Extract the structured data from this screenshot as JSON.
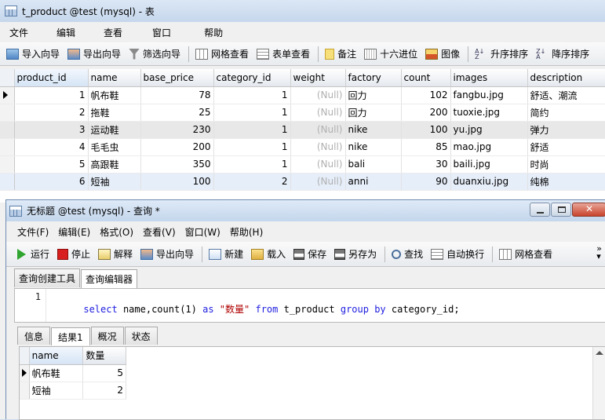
{
  "back_window": {
    "title": "t_product @test (mysql) - 表",
    "menu": [
      "文件",
      "编辑",
      "查看",
      "窗口",
      "帮助"
    ],
    "toolbar": [
      "导入向导",
      "导出向导",
      "筛选向导",
      "网格查看",
      "表单查看",
      "备注",
      "十六进位",
      "图像",
      "升序排序",
      "降序排序"
    ],
    "columns": [
      "product_id",
      "name",
      "base_price",
      "category_id",
      "weight",
      "factory",
      "count",
      "images",
      "description"
    ],
    "rows": [
      {
        "product_id": "1",
        "name": "帆布鞋",
        "base_price": "78",
        "category_id": "1",
        "weight": "(Null)",
        "factory": "回力",
        "count": "102",
        "images": "fangbu.jpg",
        "description": "舒适、潮流"
      },
      {
        "product_id": "2",
        "name": "拖鞋",
        "base_price": "25",
        "category_id": "1",
        "weight": "(Null)",
        "factory": "回力",
        "count": "200",
        "images": "tuoxie.jpg",
        "description": "简约"
      },
      {
        "product_id": "3",
        "name": "运动鞋",
        "base_price": "230",
        "category_id": "1",
        "weight": "(Null)",
        "factory": "nike",
        "count": "100",
        "images": "yu.jpg",
        "description": "弹力"
      },
      {
        "product_id": "4",
        "name": "毛毛虫",
        "base_price": "200",
        "category_id": "1",
        "weight": "(Null)",
        "factory": "nike",
        "count": "85",
        "images": "mao.jpg",
        "description": "舒适"
      },
      {
        "product_id": "5",
        "name": "高跟鞋",
        "base_price": "350",
        "category_id": "1",
        "weight": "(Null)",
        "factory": "bali",
        "count": "30",
        "images": "baili.jpg",
        "description": "时尚"
      },
      {
        "product_id": "6",
        "name": "短袖",
        "base_price": "100",
        "category_id": "2",
        "weight": "(Null)",
        "factory": "anni",
        "count": "90",
        "images": "duanxiu.jpg",
        "description": "纯棉"
      }
    ]
  },
  "front_window": {
    "title": "无标题 @test (mysql) - 查询 *",
    "menu": [
      "文件(F)",
      "编辑(E)",
      "格式(O)",
      "查看(V)",
      "窗口(W)",
      "帮助(H)"
    ],
    "toolbar": [
      "运行",
      "停止",
      "解释",
      "导出向导",
      "新建",
      "载入",
      "保存",
      "另存为",
      "查找",
      "自动换行",
      "网格查看"
    ],
    "editor_tabs": [
      "查询创建工具",
      "查询编辑器"
    ],
    "active_editor_tab": "查询编辑器",
    "line_number": "1",
    "sql": {
      "select": "select",
      "fields": " name,count(1) ",
      "as": "as",
      "alias": "\"数量\"",
      "from": "from",
      "table": " t_product ",
      "group_by": "group by",
      "group_field": " category_id;"
    },
    "result_tabs": [
      "信息",
      "结果1",
      "概况",
      "状态"
    ],
    "active_result_tab": "结果1",
    "result_columns": [
      "name",
      "数量"
    ],
    "result_rows": [
      {
        "name": "帆布鞋",
        "count": "5"
      },
      {
        "name": "短袖",
        "count": "2"
      }
    ]
  }
}
